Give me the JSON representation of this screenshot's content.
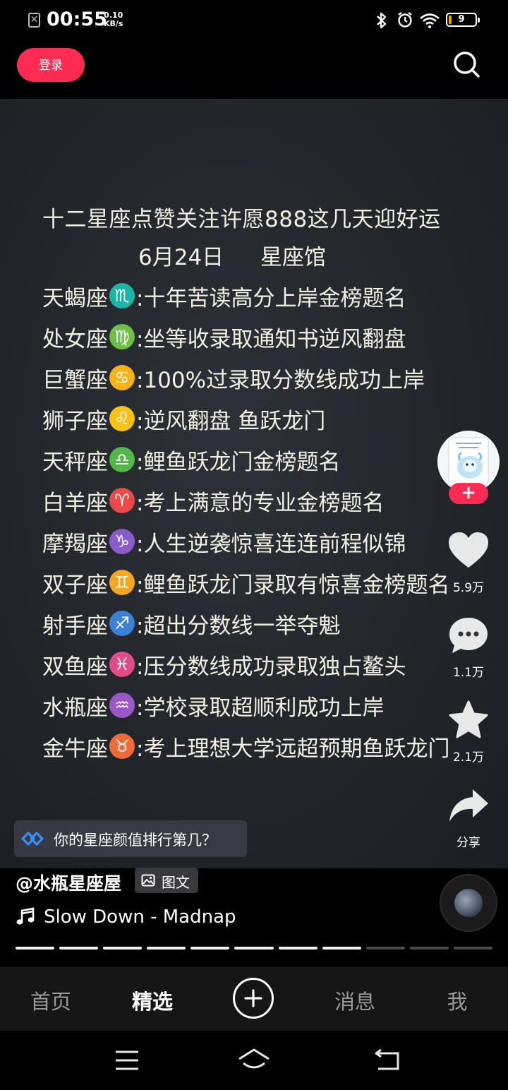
{
  "status_bar": {
    "time": "00:55",
    "speed_value": "0.10",
    "speed_unit": "KB/s",
    "battery": "9",
    "notification_icon": "x-box-icon",
    "icons": [
      "bluetooth-icon",
      "alarm-icon",
      "wifi-icon",
      "battery-icon"
    ]
  },
  "header": {
    "login_label": "登录",
    "search_icon": "search-icon"
  },
  "video_text": {
    "title": "十二星座点赞关注许愿888这几天迎好运",
    "date": "6月24日",
    "source": "星座馆",
    "rows": [
      {
        "sign": "天蝎座",
        "symbol": "♏",
        "color": "#1ab7a8",
        "wish": ":十年苦读高分上岸金榜题名"
      },
      {
        "sign": "处女座",
        "symbol": "♍",
        "color": "#6cc04a",
        "wish": ":坐等收录取通知书逆风翻盘"
      },
      {
        "sign": "巨蟹座",
        "symbol": "♋",
        "color": "#f5b21a",
        "wish": ":100%过录取分数线成功上岸"
      },
      {
        "sign": "狮子座",
        "symbol": "♌",
        "color": "#f5c21a",
        "wish": ":逆风翻盘 鱼跃龙门"
      },
      {
        "sign": "天秤座",
        "symbol": "♎",
        "color": "#52b848",
        "wish": ":鲤鱼跃龙门金榜题名"
      },
      {
        "sign": "白羊座",
        "symbol": "♈",
        "color": "#e94b4b",
        "wish": ":考上满意的专业金榜题名"
      },
      {
        "sign": "摩羯座",
        "symbol": "♑",
        "color": "#8a5cc8",
        "wish": ":人生逆袭惊喜连连前程似锦"
      },
      {
        "sign": "双子座",
        "symbol": "♊",
        "color": "#f5a623",
        "wish": ":鲤鱼跃龙门录取有惊喜金榜题名"
      },
      {
        "sign": "射手座",
        "symbol": "♐",
        "color": "#3b82d6",
        "wish": ":超出分数线一举夺魁"
      },
      {
        "sign": "双鱼座",
        "symbol": "♓",
        "color": "#e14b8a",
        "wish": ":压分数线成功录取独占鳌头"
      },
      {
        "sign": "水瓶座",
        "symbol": "♒",
        "color": "#9b59c8",
        "wish": ":学校录取超顺利成功上岸"
      },
      {
        "sign": "金牛座",
        "symbol": "♉",
        "color": "#ef6b3a",
        "wish": ":考上理想大学远超预期鱼跃龙门"
      }
    ]
  },
  "sidebar": {
    "follow_label": "+",
    "like_count": "5.9万",
    "comment_count": "1.1万",
    "favorite_count": "2.1万",
    "share_label": "分享"
  },
  "recommendation": {
    "text": "你的星座颜值排行第几？"
  },
  "post": {
    "author": "@水瓶星座屋",
    "tag": "图文",
    "music": "Slow Down - Madnap",
    "progress_total": 11,
    "progress_done": 8
  },
  "bottom_nav": {
    "items": [
      "首页",
      "精选",
      "消息",
      "我"
    ],
    "active": "精选"
  },
  "colors": {
    "accent": "#fe2c55",
    "background": "#000000"
  }
}
